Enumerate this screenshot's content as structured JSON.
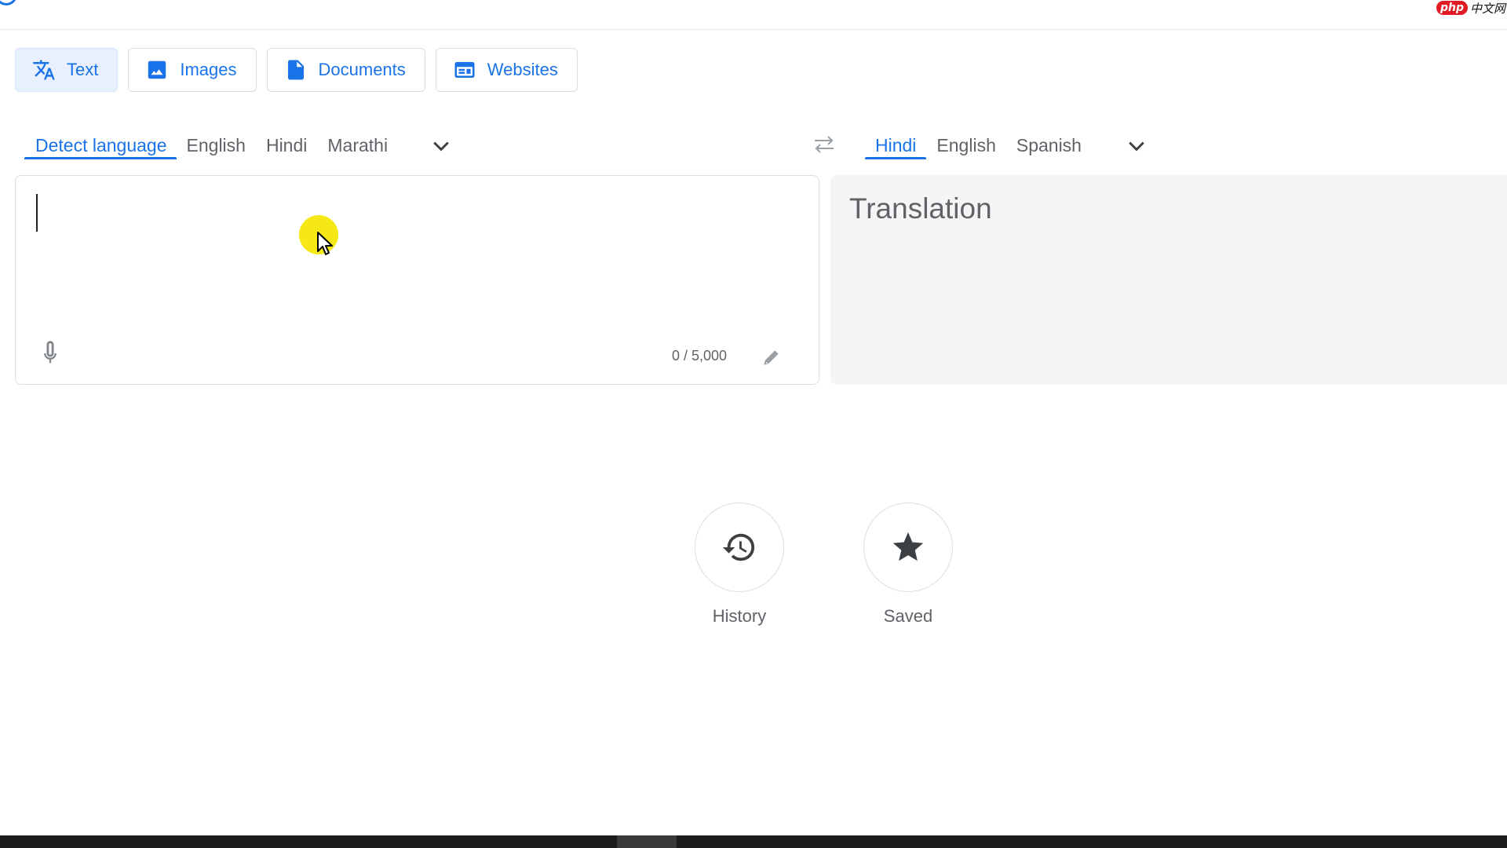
{
  "watermark": {
    "badge": "php",
    "text": "中文网"
  },
  "modes": [
    {
      "label": "Text",
      "icon": "translate-icon"
    },
    {
      "label": "Images",
      "icon": "image-icon"
    },
    {
      "label": "Documents",
      "icon": "document-icon"
    },
    {
      "label": "Websites",
      "icon": "website-icon"
    }
  ],
  "source_languages": [
    "Detect language",
    "English",
    "Hindi",
    "Marathi"
  ],
  "target_languages": [
    "Hindi",
    "English",
    "Spanish"
  ],
  "source": {
    "value": "",
    "char_count": "0 / 5,000"
  },
  "target": {
    "placeholder": "Translation"
  },
  "history": {
    "label": "History"
  },
  "saved": {
    "label": "Saved"
  },
  "colors": {
    "accent": "#1a73e8",
    "active_bg": "#e8f0fe",
    "output_bg": "#f5f5f5",
    "cursor_highlight": "#f5e600"
  }
}
